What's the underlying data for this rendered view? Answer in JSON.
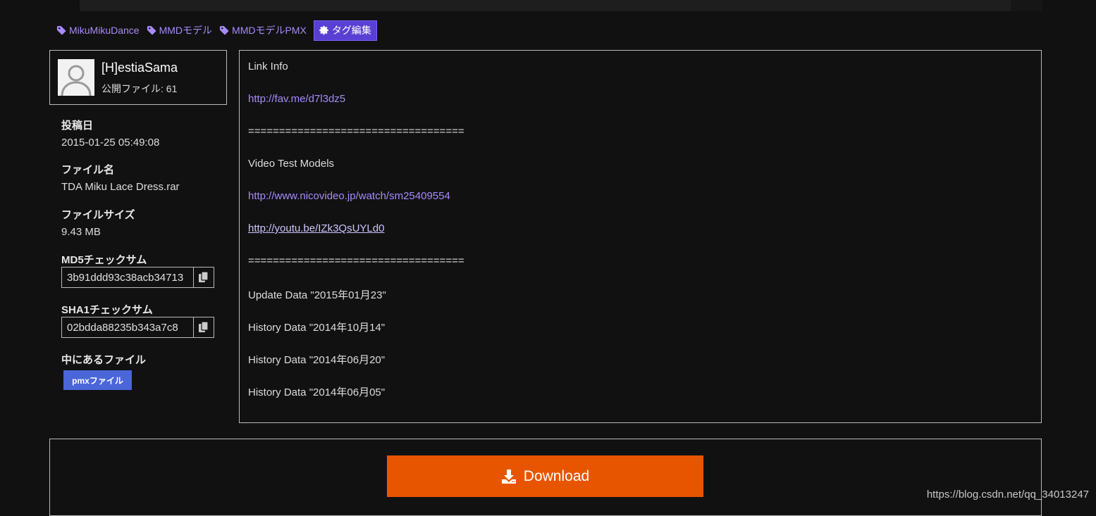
{
  "tags": [
    {
      "label": "MikuMikuDance"
    },
    {
      "label": "MMDモデル"
    },
    {
      "label": "MMDモデルPMX"
    }
  ],
  "tag_edit_label": "タグ編集",
  "user": {
    "name": "[H]estiaSama",
    "files": "公開ファイル: 61"
  },
  "meta": {
    "posted_label": "投稿日",
    "posted_value": "2015-01-25 05:49:08",
    "filename_label": "ファイル名",
    "filename_value": "TDA Miku Lace Dress.rar",
    "filesize_label": "ファイルサイズ",
    "filesize_value": "9.43 MB",
    "md5_label": "MD5チェックサム",
    "md5_value": "3b91ddd93c38acb34713",
    "sha1_label": "SHA1チェックサム",
    "sha1_value": "02bdda88235b343a7c8",
    "contents_label": "中にあるファイル",
    "contents_button": "pmxファイル"
  },
  "description": [
    {
      "text": "Link Info",
      "type": "text"
    },
    {
      "text": "http://fav.me/d7l3dz5",
      "type": "link"
    },
    {
      "text": "===================================",
      "type": "text"
    },
    {
      "text": "Video Test Models",
      "type": "text"
    },
    {
      "text": "http://www.nicovideo.jp/watch/sm25409554",
      "type": "link"
    },
    {
      "text": "http://youtu.be/IZk3QsUYLd0",
      "type": "visited-link"
    },
    {
      "text": "===================================",
      "type": "text"
    },
    {
      "text": "Update Data \"2015年01月23\"",
      "type": "text"
    },
    {
      "text": "History Data \"2014年10月14\"",
      "type": "text"
    },
    {
      "text": "History Data \"2014年06月20\"",
      "type": "text"
    },
    {
      "text": "History Data \"2014年06月05\"",
      "type": "text"
    }
  ],
  "download_label": "Download",
  "watermark": "https://blog.csdn.net/qq_34013247",
  "icons": {
    "tag": "tag-icon",
    "edit": "gear-icon",
    "copy": "copy-icon",
    "download": "download-icon"
  },
  "colors": {
    "background": "#111111",
    "link": "#a78bfa",
    "tag_edit": "#5a3fd4",
    "download": "#e85500",
    "file_type_button": "#4a66d8"
  }
}
